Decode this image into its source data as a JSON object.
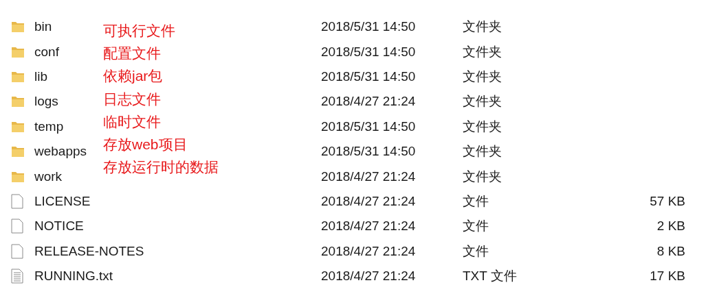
{
  "files": [
    {
      "kind": "folder",
      "name": "bin",
      "date": "2018/5/31 14:50",
      "type": "文件夹"
    },
    {
      "kind": "folder",
      "name": "conf",
      "date": "2018/5/31 14:50",
      "type": "文件夹"
    },
    {
      "kind": "folder",
      "name": "lib",
      "date": "2018/5/31 14:50",
      "type": "文件夹"
    },
    {
      "kind": "folder",
      "name": "logs",
      "date": "2018/4/27 21:24",
      "type": "文件夹"
    },
    {
      "kind": "folder",
      "name": "temp",
      "date": "2018/5/31 14:50",
      "type": "文件夹"
    },
    {
      "kind": "folder",
      "name": "webapps",
      "date": "2018/5/31 14:50",
      "type": "文件夹"
    },
    {
      "kind": "folder",
      "name": "work",
      "date": "2018/4/27 21:24",
      "type": "文件夹"
    },
    {
      "kind": "file",
      "name": "LICENSE",
      "date": "2018/4/27 21:24",
      "type": "文件",
      "size": "57 KB"
    },
    {
      "kind": "file",
      "name": "NOTICE",
      "date": "2018/4/27 21:24",
      "type": "文件",
      "size": "2 KB"
    },
    {
      "kind": "file",
      "name": "RELEASE-NOTES",
      "date": "2018/4/27 21:24",
      "type": "文件",
      "size": "8 KB"
    },
    {
      "kind": "text",
      "name": "RUNNING.txt",
      "date": "2018/4/27 21:24",
      "type": "TXT 文件",
      "size": "17 KB"
    }
  ],
  "annotations": [
    "可执行文件",
    "配置文件",
    "依赖jar包",
    "日志文件",
    "临时文件",
    "存放web项目",
    "存放运行时的数据"
  ]
}
